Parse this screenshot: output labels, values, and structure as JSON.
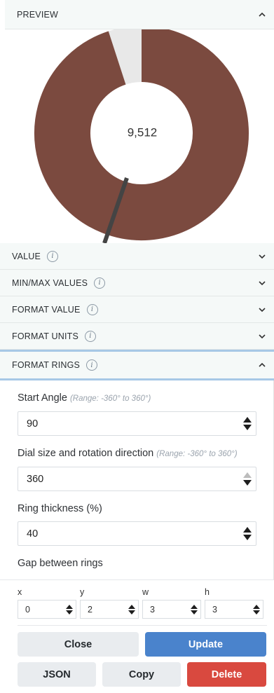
{
  "preview": {
    "title": "PREVIEW",
    "center_value": "9,512",
    "fill_fraction": 0.95,
    "colors": {
      "ring": "#7b4a3f",
      "track": "#e8e8e8",
      "needle": "#444444"
    }
  },
  "sections": {
    "value": "VALUE",
    "minmax": "MIN/MAX VALUES",
    "format_value": "FORMAT VALUE",
    "format_units": "FORMAT UNITS",
    "format_rings": "FORMAT RINGS"
  },
  "info_glyph": "i",
  "format_rings": {
    "start_angle": {
      "label": "Start Angle",
      "hint": "(Range: -360° to 360°)",
      "value": "90"
    },
    "dial_size": {
      "label": "Dial size and rotation direction",
      "hint": "(Range: -360° to 360°)",
      "value": "360"
    },
    "ring_thickness": {
      "label": "Ring thickness (%)",
      "value": "40"
    },
    "gap_label": "Gap between rings"
  },
  "grid": {
    "labels": [
      "x",
      "y",
      "w",
      "h"
    ],
    "values": [
      "0",
      "2",
      "3",
      "3"
    ]
  },
  "buttons": {
    "close": "Close",
    "update": "Update",
    "json": "JSON",
    "copy": "Copy",
    "delete": "Delete"
  }
}
